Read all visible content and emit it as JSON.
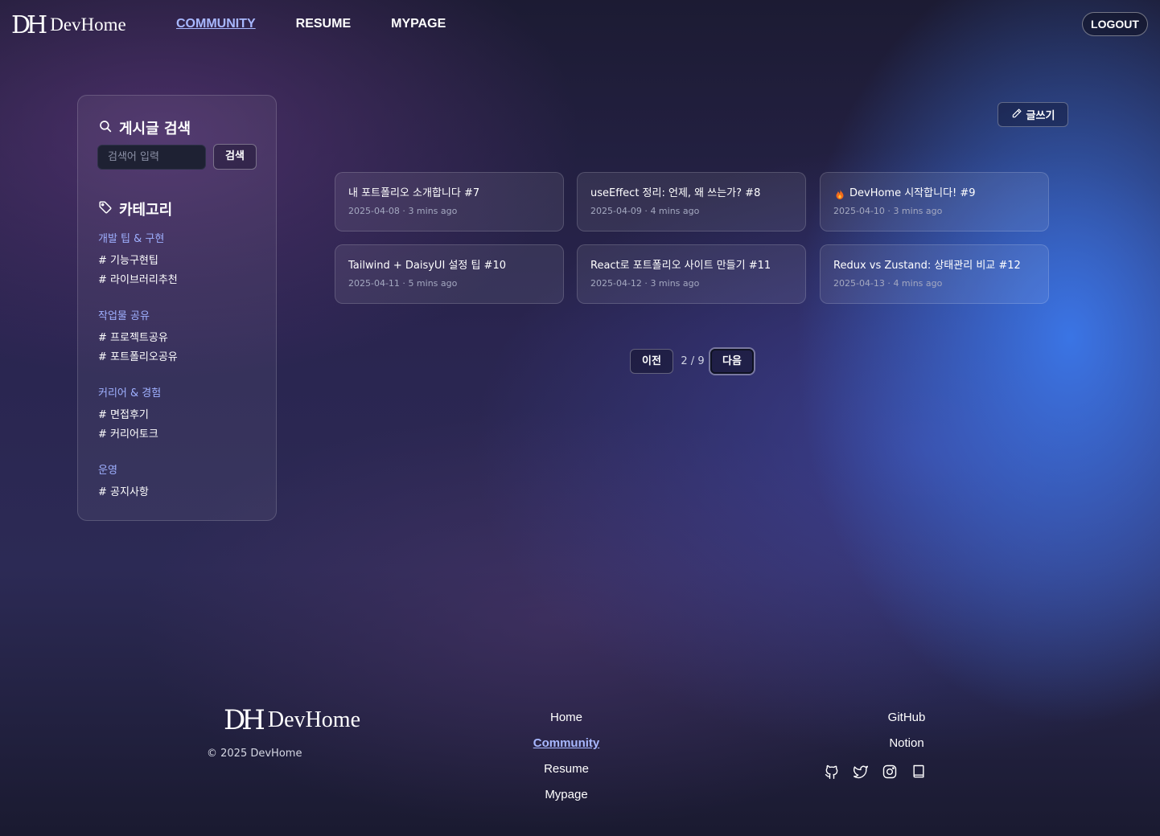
{
  "header": {
    "logo_mark": "DH",
    "logo_text": "DevHome",
    "nav": [
      {
        "label": "COMMUNITY",
        "active": true
      },
      {
        "label": "RESUME",
        "active": false
      },
      {
        "label": "MYPAGE",
        "active": false
      }
    ],
    "logout_label": "LOGOUT"
  },
  "sidebar": {
    "search_title": "게시글 검색",
    "search_placeholder": "검색어 입력",
    "search_button": "검색",
    "category_title": "카테고리",
    "groups": [
      {
        "title": "개발 팁 & 구현",
        "items": [
          "# 기능구현팁",
          "# 라이브러리추천"
        ]
      },
      {
        "title": "작업물 공유",
        "items": [
          "# 프로젝트공유",
          "# 포트폴리오공유"
        ]
      },
      {
        "title": "커리어 & 경험",
        "items": [
          "# 면접후기",
          "# 커리어토크"
        ]
      },
      {
        "title": "운영",
        "items": [
          "# 공지사항"
        ]
      }
    ]
  },
  "write_button": "글쓰기",
  "posts": [
    {
      "title": "내 포트폴리오 소개합니다 #7",
      "date": "2025-04-08",
      "read": "3 mins ago",
      "hot": false
    },
    {
      "title": "useEffect 정리: 언제, 왜 쓰는가? #8",
      "date": "2025-04-09",
      "read": "4 mins ago",
      "hot": false
    },
    {
      "title": "DevHome 시작합니다! #9",
      "date": "2025-04-10",
      "read": "3 mins ago",
      "hot": true
    },
    {
      "title": "Tailwind + DaisyUI 설정 팁 #10",
      "date": "2025-04-11",
      "read": "5 mins ago",
      "hot": false
    },
    {
      "title": "React로 포트폴리오 사이트 만들기 #11",
      "date": "2025-04-12",
      "read": "3 mins ago",
      "hot": false
    },
    {
      "title": "Redux vs Zustand: 상태관리 비교 #12",
      "date": "2025-04-13",
      "read": "4 mins ago",
      "hot": false
    }
  ],
  "pagination": {
    "prev": "이전",
    "next": "다음",
    "current": 2,
    "total": 9,
    "info": "2 / 9"
  },
  "footer": {
    "logo_mark": "DH",
    "logo_text": "DevHome",
    "copyright": "© 2025 DevHome",
    "nav_links": [
      {
        "label": "Home",
        "active": false
      },
      {
        "label": "Community",
        "active": true
      },
      {
        "label": "Resume",
        "active": false
      },
      {
        "label": "Mypage",
        "active": false
      }
    ],
    "ext_links": [
      "GitHub",
      "Notion"
    ],
    "social_icons": [
      "github-icon",
      "twitter-icon",
      "instagram-icon",
      "book-icon"
    ]
  },
  "colors": {
    "accent": "#a8b8ff",
    "glow": "#3b78eb",
    "background": "#26234a"
  }
}
